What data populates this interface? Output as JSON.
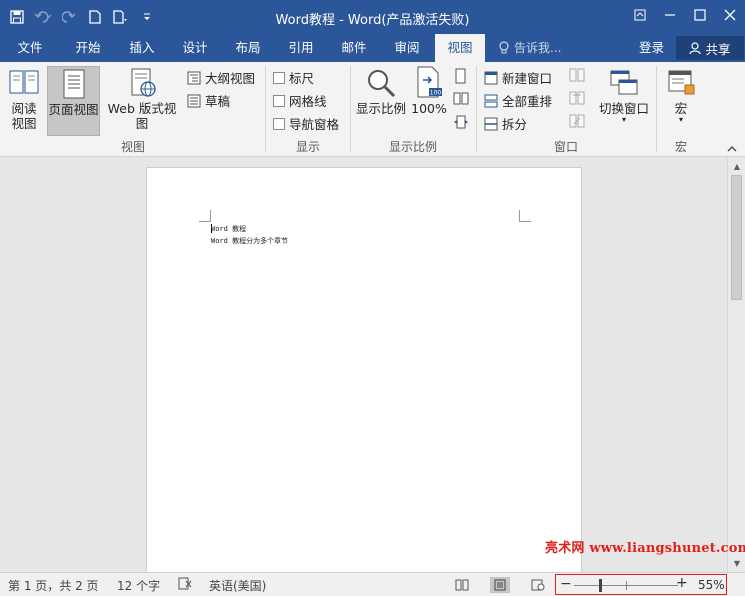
{
  "window": {
    "title": "Word教程 - Word(产品激活失败)"
  },
  "tabs": [
    {
      "label": "文件"
    },
    {
      "label": "开始"
    },
    {
      "label": "插入"
    },
    {
      "label": "设计"
    },
    {
      "label": "布局"
    },
    {
      "label": "引用"
    },
    {
      "label": "邮件"
    },
    {
      "label": "审阅"
    },
    {
      "label": "视图"
    }
  ],
  "active_tab": "视图",
  "tell_me": {
    "placeholder": "告诉我..."
  },
  "account": {
    "login": "登录",
    "share": "共享"
  },
  "ribbon": {
    "views": {
      "read_mode": "阅读\n视图",
      "read_mode_line1": "阅读",
      "read_mode_line2": "视图",
      "print_layout": "页面视图",
      "web_layout": "Web 版式视图",
      "outline": "大纲视图",
      "draft": "草稿",
      "group_label": "视图"
    },
    "show": {
      "ruler": "标尺",
      "gridlines": "网格线",
      "nav_pane": "导航窗格",
      "group_label": "显示"
    },
    "zoom": {
      "zoom": "显示比例",
      "hundred": "100%",
      "group_label": "显示比例"
    },
    "window": {
      "new_window": "新建窗口",
      "arrange_all": "全部重排",
      "split": "拆分",
      "switch_windows": "切换窗口",
      "group_label": "窗口"
    },
    "macros": {
      "macros": "宏",
      "group_label": "宏"
    }
  },
  "document": {
    "lines": [
      "Word 教程",
      "Word 教程分为多个章节"
    ]
  },
  "watermark": {
    "cn": "亮术网",
    "url": "www.liangshunet.com"
  },
  "status": {
    "page": "第 1 页，共 2 页",
    "words": "12 个字",
    "language": "英语(美国)",
    "zoom_minus": "−",
    "zoom_plus": "+",
    "zoom_percent": "55%",
    "zoom_level": 0.55
  },
  "colors": {
    "accent": "#2b579a",
    "zoom_highlight": "#e02020",
    "watermark": "#e0201a"
  }
}
